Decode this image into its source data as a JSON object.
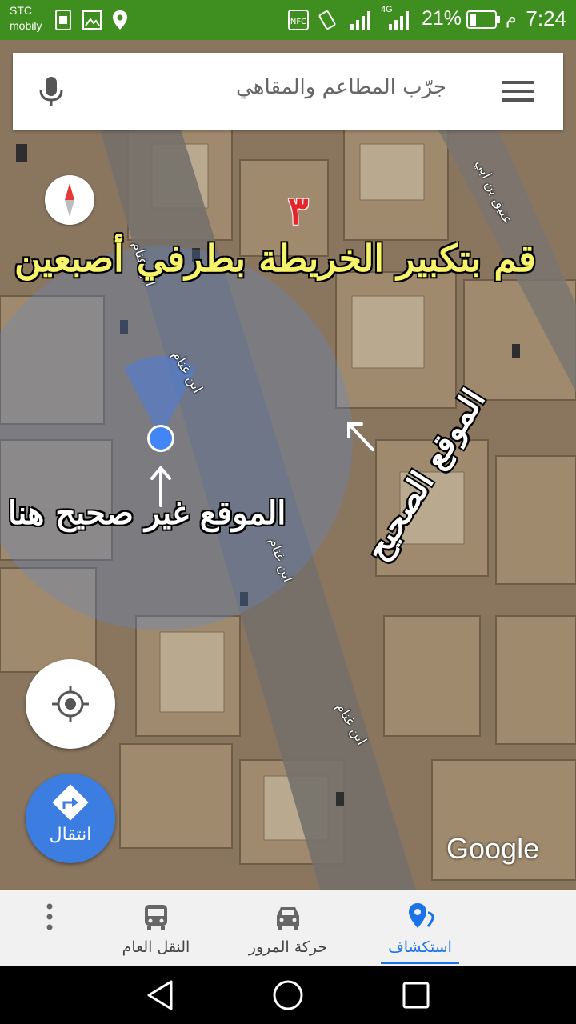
{
  "status_bar": {
    "carrier_line1": "STC",
    "carrier_line2": "mobily",
    "network": "4G",
    "battery": "21%",
    "time": "7:24",
    "ampm": "م",
    "icons": [
      "sim-icon",
      "gallery-icon",
      "location-pin-icon",
      "nfc-icon",
      "vibrate-icon",
      "signal-icon",
      "battery-icon"
    ]
  },
  "search": {
    "placeholder": "جرّب المطاعم والمقاهي",
    "mic_icon": "microphone-icon",
    "menu_icon": "hamburger-menu-icon"
  },
  "map": {
    "attribution": "Google",
    "streets": [
      "ابن غنام",
      "ابن غنام",
      "ابن غنام",
      "ابن غنام",
      "عتيق بن ابي"
    ],
    "annotations": {
      "step_number": "٣",
      "instruction": "قم بتكبير الخريطة بطرفي أصبعين",
      "wrong_location": "الموقع غير صحيح هنا",
      "correct_location": "الموقع الصحيح"
    }
  },
  "controls": {
    "my_location_icon": "my-location-icon",
    "navigate_label": "انتقال",
    "compass_icon": "compass-icon"
  },
  "bottom_nav": {
    "tabs": [
      {
        "label": "استكشاف",
        "icon": "explore-pin-icon",
        "active": true
      },
      {
        "label": "حركة المرور",
        "icon": "car-icon",
        "active": false
      },
      {
        "label": "النقل العام",
        "icon": "bus-icon",
        "active": false
      }
    ],
    "more_icon": "more-vert-icon"
  },
  "colors": {
    "status_bar": "#3e8f1f",
    "accent": "#1a73e8",
    "location_dot": "#4285f4",
    "annotation_yellow": "#f7f36a",
    "annotation_red": "#e8232c"
  }
}
